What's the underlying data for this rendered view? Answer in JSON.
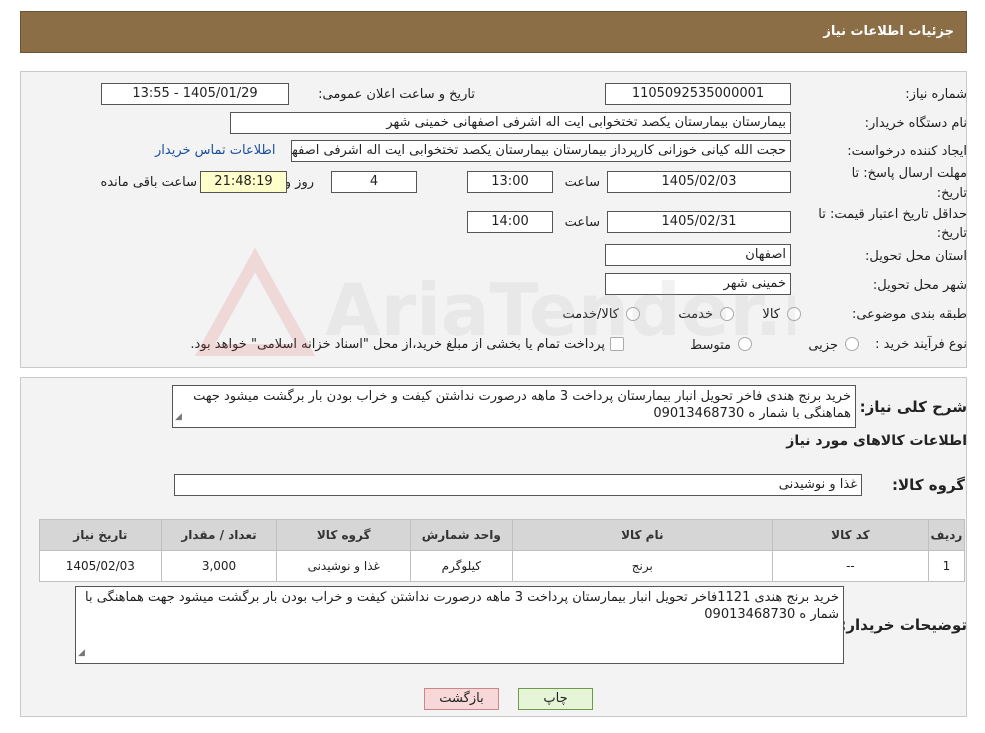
{
  "header": {
    "title": "جزئیات اطلاعات نیاز"
  },
  "fields": {
    "need_number_label": "شماره نیاز:",
    "need_number": "1105092535000001",
    "announce_label": "تاریخ و ساعت اعلان عمومی:",
    "announce_value": "1405/01/29 - 13:55",
    "buyer_org_label": "نام دستگاه خریدار:",
    "buyer_org": "بیمارستان بیمارستان یکصد تختخوابی ایت اله اشرفی اصفهانی خمینی شهر",
    "requester_label": "ایجاد کننده درخواست:",
    "requester": "حجت الله کیانی خوزانی کارپرداز بیمارستان بیمارستان یکصد تختخوابی ایت اله اشرفی اصفهانی",
    "contact_link": "اطلاعات تماس خریدار",
    "deadline_label_1": "مهلت ارسال پاسخ: تا",
    "deadline_label_2": "تاریخ:",
    "deadline_date": "1405/02/03",
    "time_label": "ساعت",
    "deadline_time": "13:00",
    "days_value": "4",
    "days_label": "روز و",
    "remaining_time": "21:48:19",
    "remaining_label": "ساعت باقی مانده",
    "validity_label_1": "حداقل تاریخ اعتبار قیمت: تا",
    "validity_label_2": "تاریخ:",
    "validity_date": "1405/02/31",
    "validity_time": "14:00",
    "province_label": "استان محل تحویل:",
    "province": "اصفهان",
    "city_label": "شهر محل تحویل:",
    "city": "خمینی شهر",
    "category_label": "طبقه بندی موضوعی:",
    "category_options": [
      "کالا",
      "خدمت",
      "کالا/خدمت"
    ],
    "process_label": "نوع فرآیند خرید :",
    "process_options": [
      "جزیی",
      "متوسط"
    ],
    "process_note": "پرداخت تمام یا بخشی از مبلغ خرید،از محل \"اسناد خزانه اسلامی\" خواهد بود."
  },
  "summary": {
    "label": "شرح کلی نیاز:",
    "text": "خرید برنج هندی فاخر تحویل انبار بیمارستان پرداخت  3   ماهه درصورت نداشتن کیفت و خراب بودن بار برگشت میشود جهت هماهنگی با شمار ه 09013468730"
  },
  "goods": {
    "section_title": "اطلاعات کالاهای مورد نیاز",
    "group_label": "گروه کالا:",
    "group_value": "غذا و نوشیدنی",
    "columns": [
      "ردیف",
      "کد کالا",
      "نام کالا",
      "واحد شمارش",
      "گروه کالا",
      "تعداد / مقدار",
      "تاریخ نیاز"
    ],
    "rows": [
      [
        "1",
        "--",
        "برنج",
        "کیلوگرم",
        "غذا و نوشیدنی",
        "3,000",
        "1405/02/03"
      ]
    ]
  },
  "buyer_notes": {
    "label": "توضیحات خریدار:",
    "text": "خرید برنج هندی 1121فاخر تحویل انبار بیمارستان پرداخت  3   ماهه درصورت نداشتن کیفت و خراب بودن بار برگشت میشود جهت هماهنگی با شمار ه 09013468730"
  },
  "buttons": {
    "print": "چاپ",
    "back": "بازگشت"
  },
  "watermark": {
    "text": "AriaTender.neT"
  },
  "colors": {
    "header_bg": "#8b6e45",
    "highlight": "#ffffcc",
    "back_button": "#f7d7d7",
    "print_button": "#e6f5d8"
  }
}
